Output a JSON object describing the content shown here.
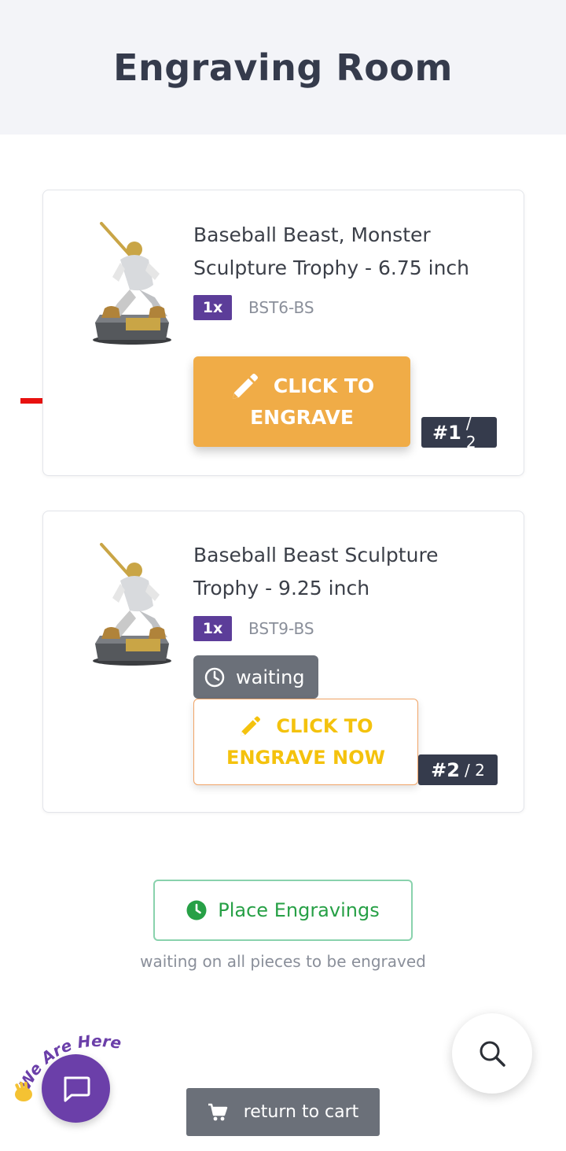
{
  "page": {
    "title": "Engraving Room"
  },
  "items": [
    {
      "title": "Baseball Beast, Monster Sculpture Trophy - 6.75 inch",
      "qty": "1x",
      "sku": "BST6-BS",
      "button_line1": "CLICK TO",
      "button_line2": "ENGRAVE",
      "index": "#1",
      "of": "/ 2"
    },
    {
      "title": "Baseball Beast Sculpture Trophy - 9.25 inch",
      "qty": "1x",
      "sku": "BST9-BS",
      "status": "waiting",
      "button_line1": "CLICK TO",
      "button_line2": "ENGRAVE NOW",
      "index": "#2",
      "of": "/ 2"
    }
  ],
  "place": {
    "label": "Place Engravings",
    "note": "waiting on all pieces to be engraved"
  },
  "chat": {
    "badge_text": "We Are Here!"
  },
  "cart": {
    "label": "return to cart"
  },
  "colors": {
    "accent_orange": "#f0ac47",
    "qty_purple": "#5c3d99",
    "success_green": "#27a046",
    "dark_navy": "#353b4c",
    "gray_button": "#6b7079",
    "arrow_red": "#e8110f"
  },
  "icons": {
    "engrave": "pencil-icon",
    "waiting": "clock-icon",
    "place": "clock-filled-icon",
    "chat": "chat-bubble-icon",
    "search": "search-icon",
    "cart": "cart-icon",
    "wave": "waving-hand-icon"
  }
}
